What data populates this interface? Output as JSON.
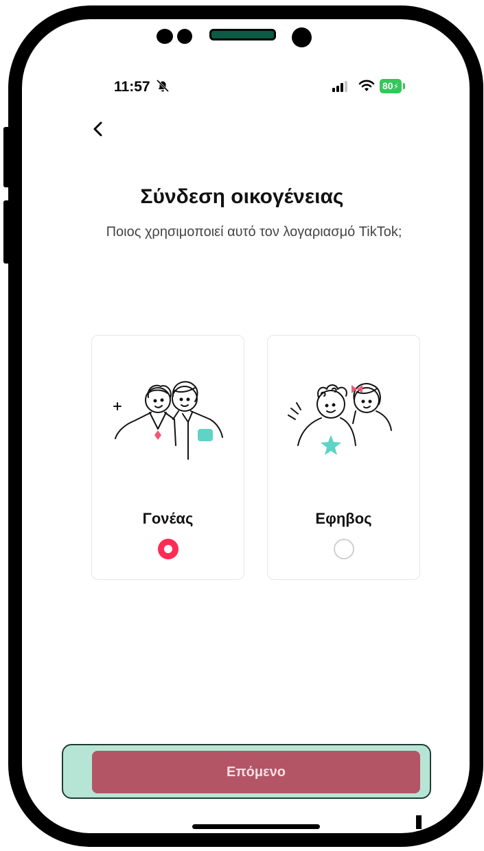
{
  "status_bar": {
    "time": "11:57",
    "battery": "80",
    "icons": [
      "bell-slash-icon",
      "signal-icon",
      "wifi-icon",
      "battery-charging-icon"
    ]
  },
  "header": {
    "back_icon": "chevron-left-icon"
  },
  "main": {
    "title": "Σύνδεση οικογένειας",
    "subtitle": "Ποιος χρησιμοποιεί αυτό τον λογαριασμό TikTok;"
  },
  "options": [
    {
      "label": "Γονέας",
      "selected": true,
      "illustration": "parents-illustration"
    },
    {
      "label": "Εφηβος",
      "selected": false,
      "illustration": "teens-illustration"
    }
  ],
  "footer": {
    "next_label": "Επόμενο"
  },
  "colors": {
    "accent": "#fe2c55",
    "button_bg": "#b45566",
    "button_highlight": "#b7e5d5",
    "illus_teal": "#5fd3c6",
    "illus_pink": "#f0587a",
    "battery": "#34c759"
  }
}
